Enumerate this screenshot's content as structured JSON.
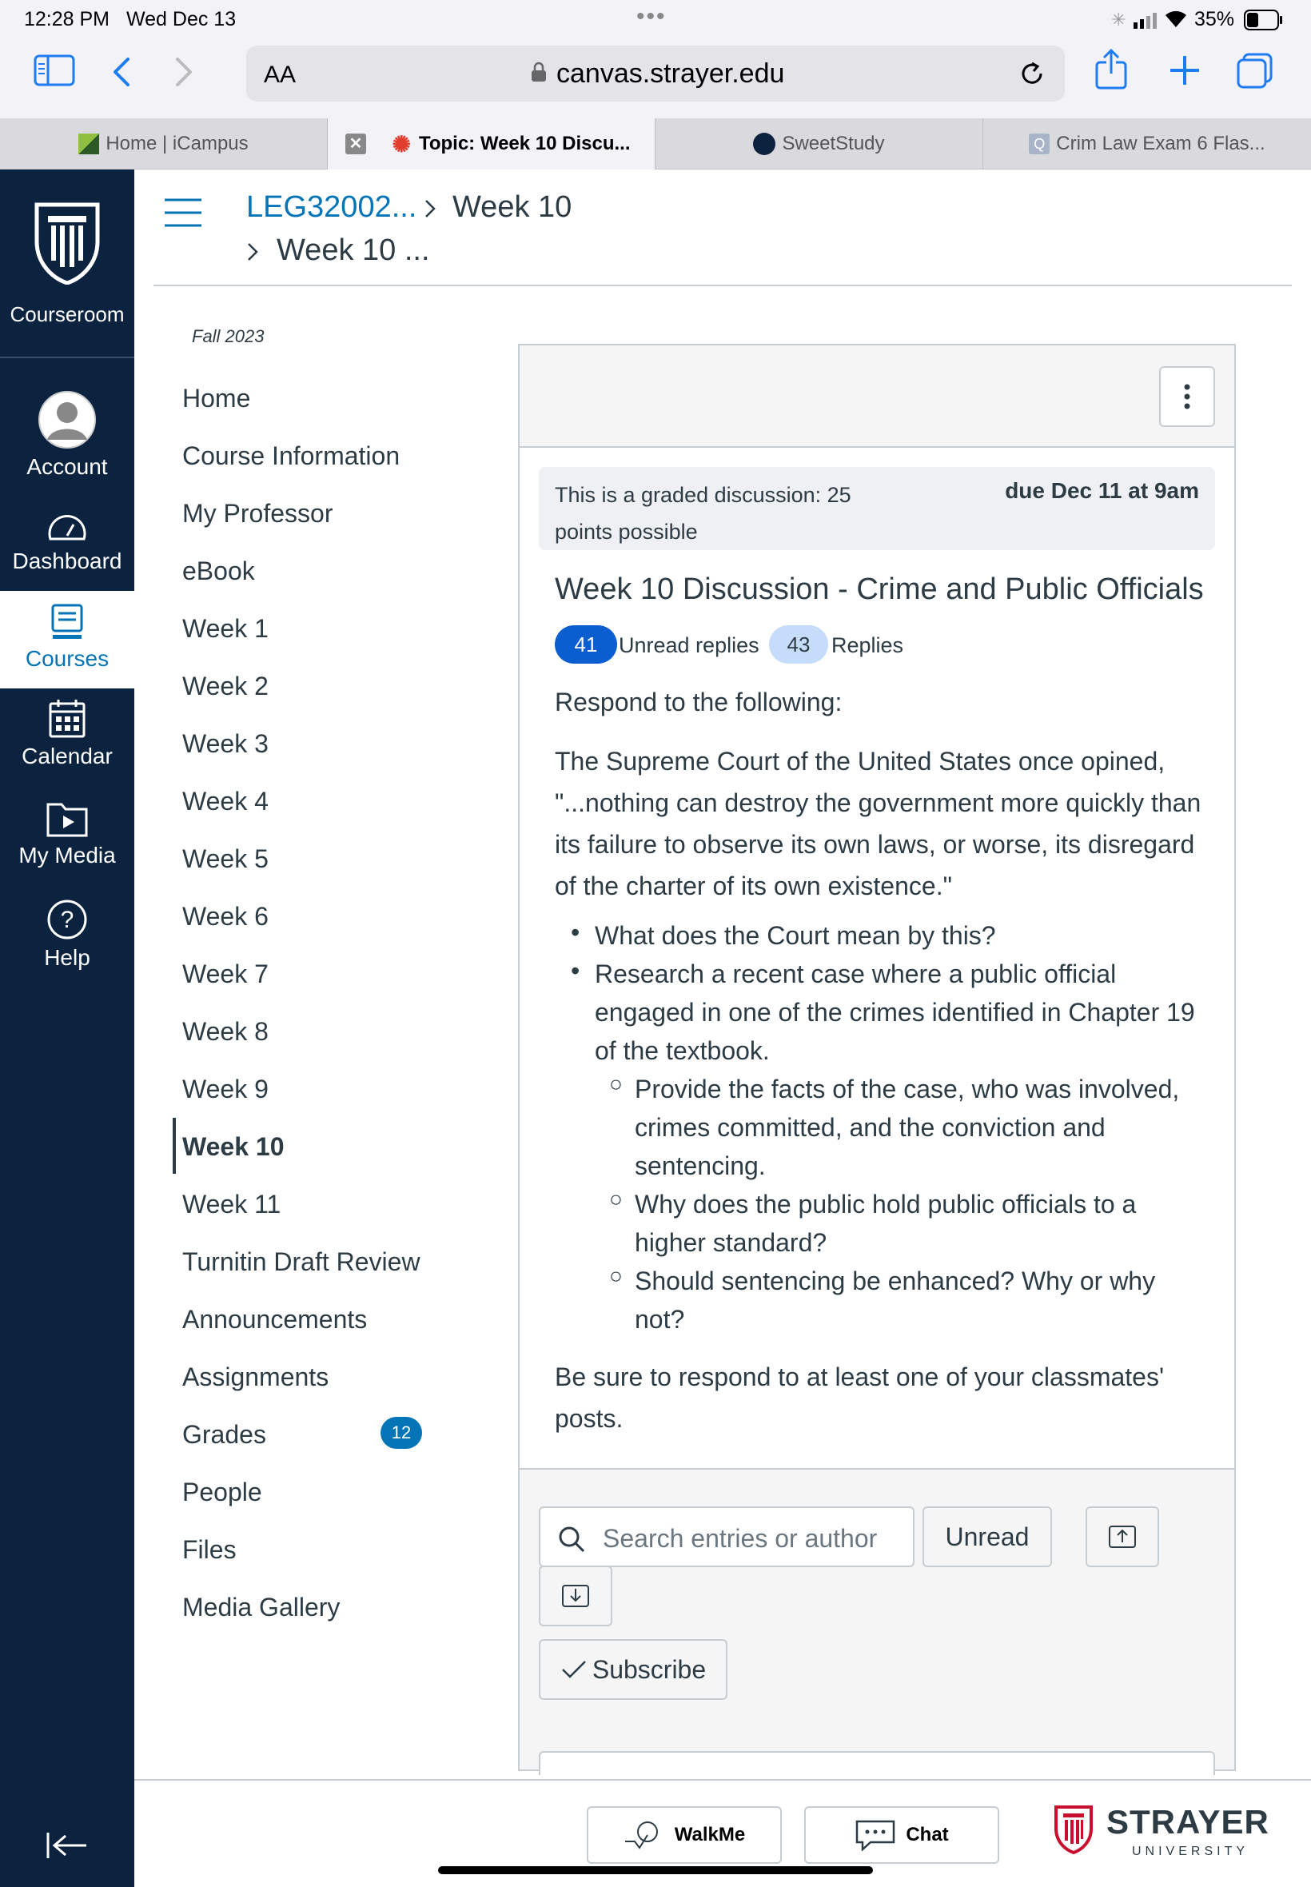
{
  "status": {
    "time": "12:28 PM",
    "date": "Wed Dec 13",
    "battery": "35%"
  },
  "browser": {
    "url": "canvas.strayer.edu",
    "text_size": "AA"
  },
  "tabs": [
    {
      "label": "Home | iCampus"
    },
    {
      "label": "Topic: Week 10 Discu..."
    },
    {
      "label": "SweetStudy"
    },
    {
      "label": "Crim Law Exam 6 Flas..."
    }
  ],
  "globalnav": {
    "courseroom": "Courseroom",
    "account": "Account",
    "dashboard": "Dashboard",
    "courses": "Courses",
    "calendar": "Calendar",
    "media": "My Media",
    "help": "Help"
  },
  "breadcrumb": {
    "course": "LEG32002...",
    "week": "Week 10",
    "topic": "Week 10 ..."
  },
  "term": "Fall 2023",
  "course_nav": [
    {
      "label": "Home"
    },
    {
      "label": "Course Information"
    },
    {
      "label": "My Professor"
    },
    {
      "label": "eBook"
    },
    {
      "label": "Week 1"
    },
    {
      "label": "Week 2"
    },
    {
      "label": "Week 3"
    },
    {
      "label": "Week 4"
    },
    {
      "label": "Week 5"
    },
    {
      "label": "Week 6"
    },
    {
      "label": "Week 7"
    },
    {
      "label": "Week 8"
    },
    {
      "label": "Week 9"
    },
    {
      "label": "Week 10"
    },
    {
      "label": "Week 11"
    },
    {
      "label": "Turnitin Draft Review"
    },
    {
      "label": "Announcements"
    },
    {
      "label": "Assignments"
    },
    {
      "label": "Grades"
    },
    {
      "label": "People"
    },
    {
      "label": "Files"
    },
    {
      "label": "Media Gallery"
    }
  ],
  "grades_badge": "12",
  "discussion": {
    "graded_note": "This is a graded discussion: 25 points possible",
    "due": "due Dec 11 at 9am",
    "title": "Week 10 Discussion - Crime and Public Officials",
    "unread_count": "41",
    "unread_label": "Unread replies",
    "replies_count": "43",
    "replies_label": "Replies",
    "intro": "Respond to the following:",
    "quote": "The Supreme Court of the United States once opined, \"...nothing can destroy the government more quickly than its failure to observe its own laws, or worse, its disregard of the charter of its own existence.\"",
    "bullet1": "What does the Court mean by this?",
    "bullet2": "Research a recent case where a public official engaged in one of the crimes identified in Chapter 19 of the textbook.",
    "sub1": "Provide the facts of the case, who was involved, crimes committed, and the conviction and sentencing.",
    "sub2": "Why does the public hold public officials to a higher standard?",
    "sub3": "Should sentencing be enhanced? Why or why not?",
    "closing": "Be sure to respond to at least one of your classmates' posts."
  },
  "controls": {
    "search_placeholder": "Search entries or author",
    "unread": "Unread",
    "subscribe": "Subscribe"
  },
  "footer": {
    "walkme": "WalkMe",
    "chat": "Chat",
    "logo": "STRAYER",
    "logo_sub": "UNIVERSITY"
  }
}
